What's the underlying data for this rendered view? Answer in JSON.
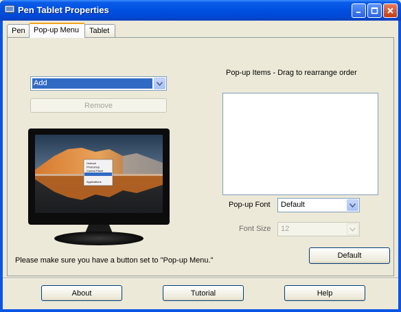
{
  "window": {
    "title": "Pen Tablet Properties"
  },
  "tabs": [
    {
      "label": "Pen"
    },
    {
      "label": "Pop-up Menu"
    },
    {
      "label": "Tablet"
    }
  ],
  "action_select": {
    "value": "Add"
  },
  "remove_label": "Remove",
  "popup_items_label": "Pop-up Items - Drag to rearrange order",
  "popup_font": {
    "label": "Pop-up Font",
    "value": "Default"
  },
  "font_size": {
    "label": "Font Size",
    "value": "12"
  },
  "default_label": "Default",
  "hint_text": "Please make sure you have a button set to \"Pop-up Menu.\"",
  "footer": {
    "about": "About",
    "tutorial": "Tutorial",
    "help": "Help"
  },
  "preview_menu": [
    "Outlook",
    "Photoshop",
    "Control Panel",
    "",
    "Applications"
  ],
  "colors": {
    "titlebar": "#0050e0",
    "selection": "#316ac5",
    "tab_accent": "#f3a21c"
  }
}
